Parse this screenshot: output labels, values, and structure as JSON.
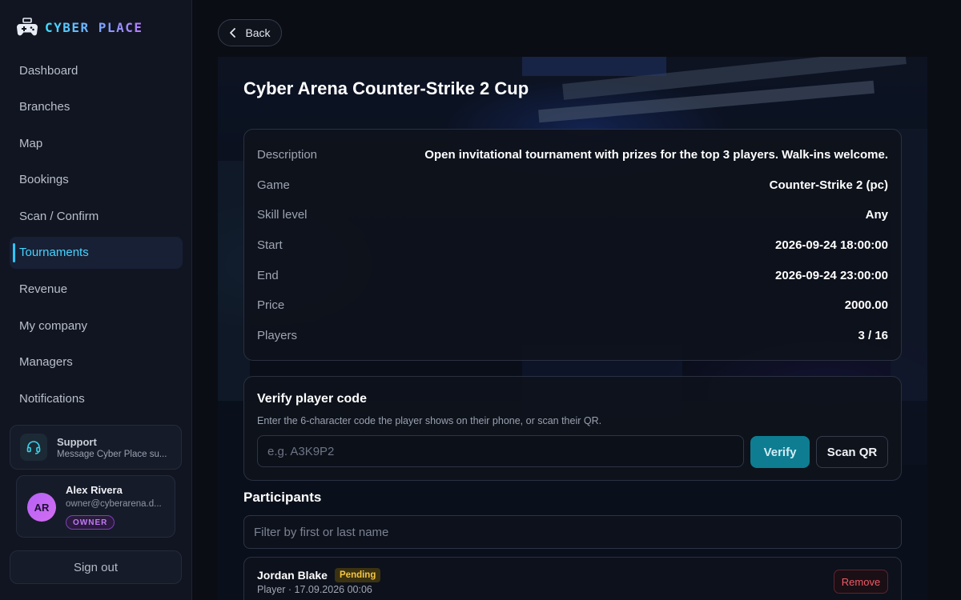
{
  "brand": {
    "name": "CYBER PLACE",
    "logo_icon": "gamepad-icon"
  },
  "sidebar": {
    "items": [
      {
        "label": "Dashboard"
      },
      {
        "label": "Branches"
      },
      {
        "label": "Map"
      },
      {
        "label": "Bookings"
      },
      {
        "label": "Scan / Confirm"
      },
      {
        "label": "Tournaments",
        "active": true
      },
      {
        "label": "Revenue"
      },
      {
        "label": "My company"
      },
      {
        "label": "Managers"
      },
      {
        "label": "Notifications"
      }
    ],
    "support": {
      "title": "Support",
      "subtitle": "Message Cyber Place su...",
      "icon": "headset-icon"
    },
    "user": {
      "initials": "AR",
      "name": "Alex Rivera",
      "email": "owner@cyberarena.d...",
      "role": "OWNER"
    },
    "signout_label": "Sign out"
  },
  "header": {
    "back_label": "Back"
  },
  "tournament": {
    "title": "Cyber Arena Counter-Strike 2 Cup",
    "details": [
      {
        "label": "Description",
        "value": "Open invitational tournament with prizes for the top 3 players. Walk-ins welcome."
      },
      {
        "label": "Game",
        "value": "Counter-Strike 2 (pc)"
      },
      {
        "label": "Skill level",
        "value": "Any"
      },
      {
        "label": "Start",
        "value": "2026-09-24 18:00:00"
      },
      {
        "label": "End",
        "value": "2026-09-24 23:00:00"
      },
      {
        "label": "Price",
        "value": "2000.00"
      },
      {
        "label": "Players",
        "value": "3 / 16"
      }
    ]
  },
  "verify": {
    "title": "Verify player code",
    "hint": "Enter the 6-character code the player shows on their phone, or scan their QR.",
    "placeholder": "e.g. A3K9P2",
    "value": "",
    "verify_label": "Verify",
    "scan_label": "Scan QR"
  },
  "participants": {
    "title": "Participants",
    "filter_placeholder": "Filter by first or last name",
    "items": [
      {
        "name": "Jordan Blake",
        "status": "Pending",
        "meta": "Player · 17.09.2026 00:06",
        "remove_label": "Remove"
      }
    ]
  },
  "colors": {
    "accent": "#46d4ff",
    "verify_button": "#0e7d92",
    "pending": "#f5c542",
    "danger": "#ef5a67",
    "owner_badge": "#c07bf3"
  }
}
